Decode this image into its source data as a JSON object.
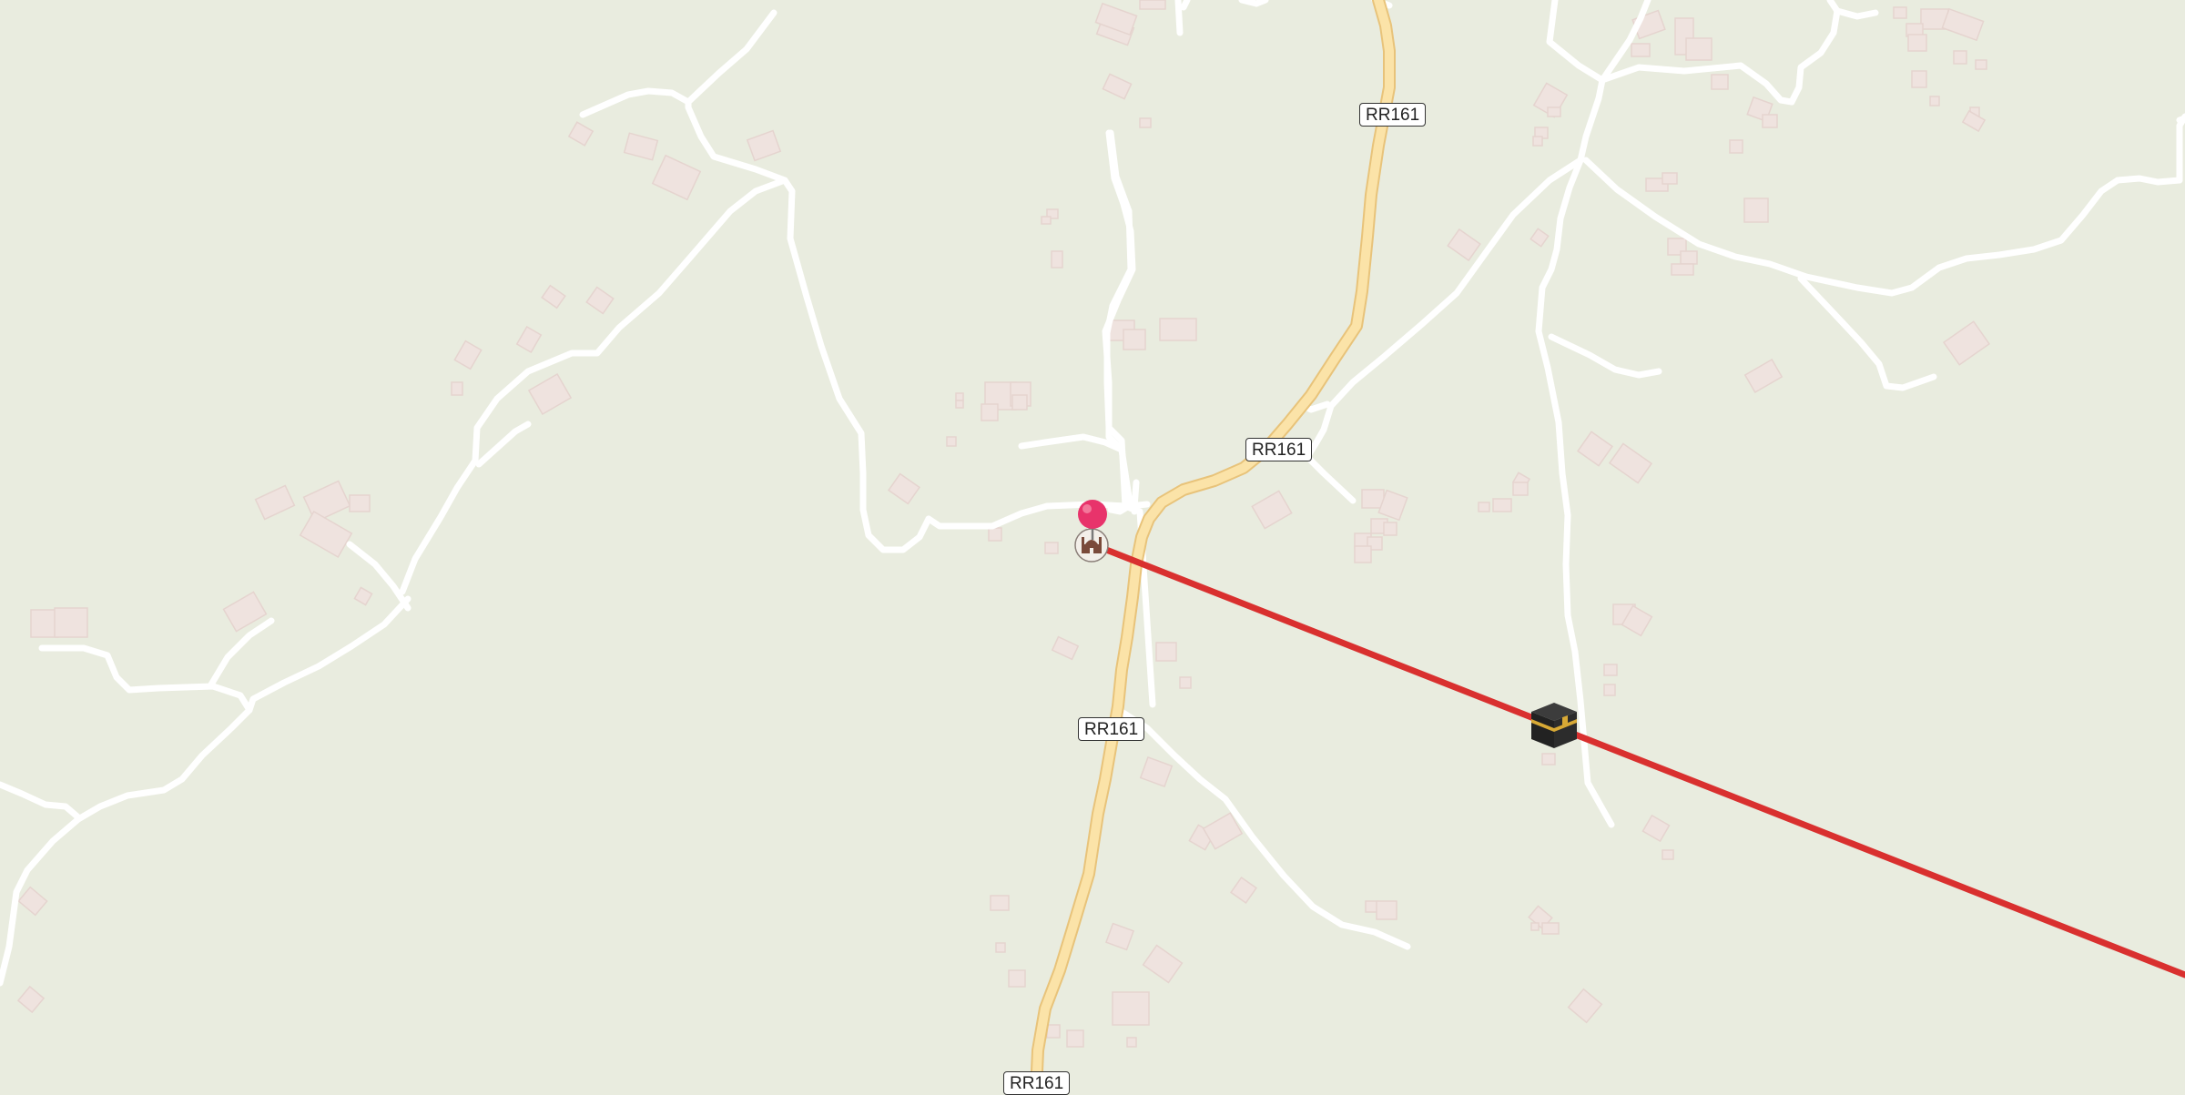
{
  "map": {
    "road_labels": [
      "RR161",
      "RR161",
      "RR161",
      "RR161"
    ],
    "colors": {
      "background": "#e9ecdf",
      "minor_road": "#ffffff",
      "major_road": "#fbe3a8",
      "major_road_casing": "#e8c37a",
      "building": "#efe3df",
      "qibla_line": "#d9302f",
      "location_pin": "#e8336b"
    },
    "markers": {
      "location_pin": "map-pin-icon",
      "mosque": "mosque-icon",
      "kaaba": "kaaba-icon"
    }
  }
}
